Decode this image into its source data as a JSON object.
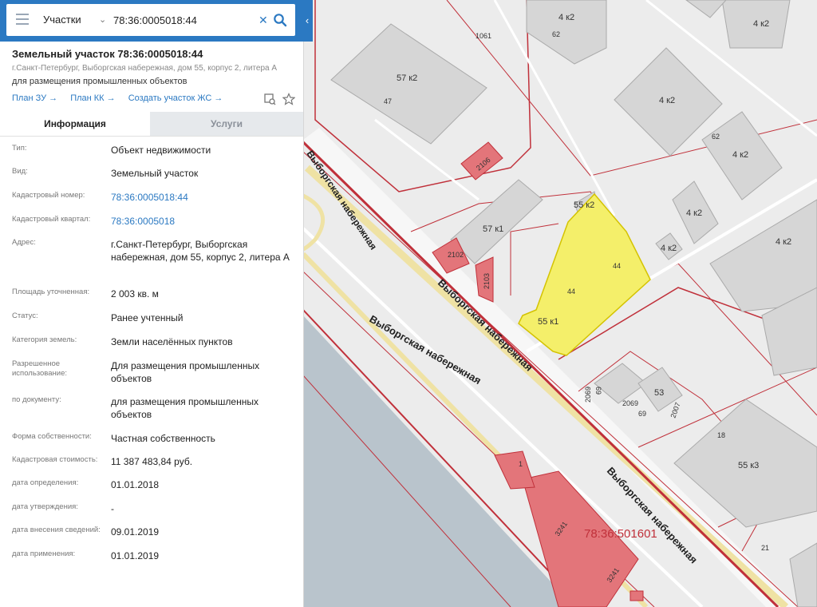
{
  "search": {
    "category": "Участки",
    "query": "78:36:0005018:44"
  },
  "parcel": {
    "title": "Земельный участок 78:36:0005018:44",
    "address": "г.Санкт-Петербург, Выборгская набережная, дом 55, корпус 2, литера А",
    "purpose": "для размещения промышленных объектов",
    "links": [
      "План ЗУ →",
      "План КК →",
      "Создать участок ЖС →"
    ]
  },
  "tabs": [
    "Информация",
    "Услуги"
  ],
  "info": [
    {
      "label": "Тип:",
      "value": "Объект недвижимости"
    },
    {
      "label": "Вид:",
      "value": "Земельный участок"
    },
    {
      "label": "Кадастровый номер:",
      "value": "78:36:0005018:44",
      "link": true
    },
    {
      "label": "Кадастровый квартал:",
      "value": "78:36:0005018",
      "link": true
    },
    {
      "label": "Адрес:",
      "value": "г.Санкт-Петербург, Выборгская набережная, дом 55, корпус 2, литера А"
    },
    {
      "label": "Площадь уточненная:",
      "value": "2 003 кв. м"
    },
    {
      "label": "Статус:",
      "value": "Ранее учтенный"
    },
    {
      "label": "Категория земель:",
      "value": "Земли населённых пунктов"
    },
    {
      "label": "Разрешенное использование:",
      "value": "Для размещения промышленных объектов"
    },
    {
      "label": "по документу:",
      "value": "для размещения промышленных объектов"
    },
    {
      "label": "Форма собственности:",
      "value": "Частная собственность"
    },
    {
      "label": "Кадастровая стоимость:",
      "value": "11 387 483,84 руб."
    },
    {
      "label": "дата определения:",
      "value": "01.01.2018"
    },
    {
      "label": "дата утверждения:",
      "value": "-"
    },
    {
      "label": "дата внесения сведений:",
      "value": "09.01.2019"
    },
    {
      "label": "дата применения:",
      "value": "01.01.2019"
    }
  ],
  "map": {
    "street_labels": [
      "Выборгская набережная",
      "Выборгская набережная",
      "Выборгская набережная"
    ],
    "quarter_label": "78:36:501601",
    "building_labels": [
      "57 к2",
      "47",
      "1061",
      "62",
      "4 к2",
      "4 к2",
      "4 к2",
      "62",
      "4 к2",
      "4 к2",
      "4 к2",
      "4 к2",
      "2106",
      "55 к2",
      "57 к1",
      "2102",
      "2103",
      "44",
      "44",
      "55 к1",
      "53",
      "2069",
      "69",
      "2069",
      "69",
      "2007",
      "18",
      "55 к3",
      "21",
      "1",
      "3241",
      "3241"
    ]
  },
  "colors": {
    "header": "#2b79c2",
    "link": "#2b79c2",
    "selected_parcel": "#f4ef6a",
    "parcel_border": "#c0303a",
    "water": "#b9c4cc"
  }
}
